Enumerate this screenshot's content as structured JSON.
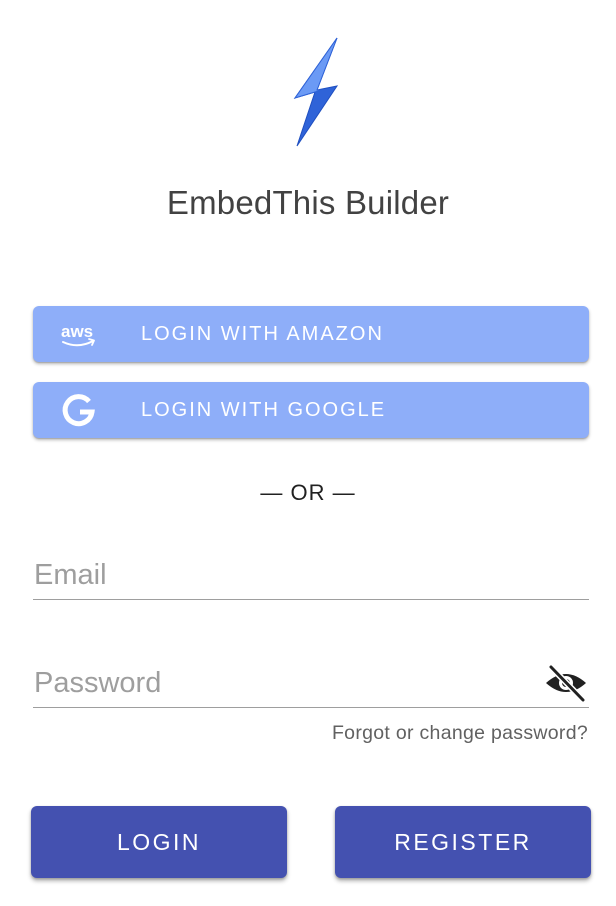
{
  "app": {
    "title": "EmbedThis Builder",
    "logo_icon": "lightning-bolt-icon"
  },
  "social_login": {
    "amazon": {
      "label": "LOGIN WITH AMAZON",
      "icon": "aws-icon",
      "icon_text": "aws"
    },
    "google": {
      "label": "LOGIN WITH GOOGLE",
      "icon": "google-g-icon"
    }
  },
  "divider_text": "— OR —",
  "form": {
    "email": {
      "placeholder": "Email",
      "value": ""
    },
    "password": {
      "placeholder": "Password",
      "value": "",
      "toggle_icon": "eye-off-icon"
    },
    "forgot_link": "Forgot or change password?"
  },
  "actions": {
    "login_label": "LOGIN",
    "register_label": "REGISTER"
  },
  "colors": {
    "social_button": "#8eaef9",
    "primary_button": "#4451b0",
    "logo_light": "#6b9af5",
    "logo_dark": "#2f63d8",
    "title_text": "#424242",
    "placeholder": "#9e9e9e"
  }
}
